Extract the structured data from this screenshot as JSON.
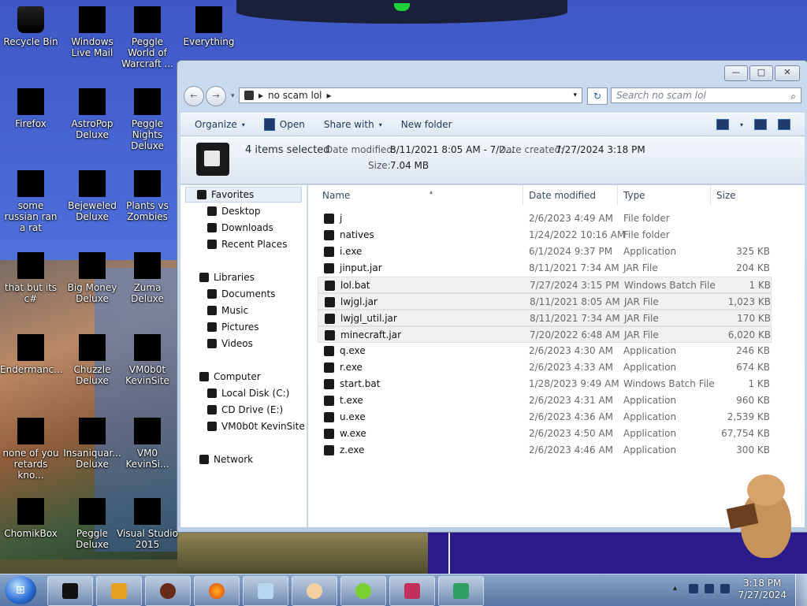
{
  "desktop": {
    "icons": [
      {
        "label": "Recycle Bin",
        "icon": "recycle-bin-icon"
      },
      {
        "label": "Windows Live Mail",
        "icon": "mail-icon"
      },
      {
        "label": "Peggle World of Warcraft ...",
        "icon": "peggle-icon"
      },
      {
        "label": "Everything",
        "icon": "everything-icon"
      },
      {
        "label": "Firefox",
        "icon": "firefox-icon"
      },
      {
        "label": "AstroPop Deluxe",
        "icon": "astropop-icon"
      },
      {
        "label": "Peggle Nights Deluxe",
        "icon": "peggle-nights-icon"
      },
      {
        "label": "some russian ran a rat",
        "icon": "app-icon"
      },
      {
        "label": "Bejeweled Deluxe",
        "icon": "bejeweled-icon"
      },
      {
        "label": "Plants vs Zombies",
        "icon": "plants-vs-zombies-icon"
      },
      {
        "label": "that but its c#",
        "icon": "app-icon"
      },
      {
        "label": "Big Money Deluxe",
        "icon": "big-money-icon"
      },
      {
        "label": "Zuma Deluxe",
        "icon": "zuma-icon"
      },
      {
        "label": "Endermanc...",
        "icon": "app-icon"
      },
      {
        "label": "Chuzzle Deluxe",
        "icon": "chuzzle-icon"
      },
      {
        "label": "VM0b0t KevinSite",
        "icon": "vm-icon"
      },
      {
        "label": "none of you retards kno...",
        "icon": "app-icon"
      },
      {
        "label": "Insaniquar... Deluxe",
        "icon": "insaniquarium-icon"
      },
      {
        "label": "VM0 KevinSi...",
        "icon": "vm-icon"
      },
      {
        "label": "ChomikBox",
        "icon": "chomikbox-icon"
      },
      {
        "label": "Peggle Deluxe",
        "icon": "peggle-icon"
      },
      {
        "label": "Visual Studio 2015",
        "icon": "visual-studio-icon"
      }
    ]
  },
  "window": {
    "caption_buttons": [
      "—",
      "□",
      "✕"
    ],
    "nav_back": "←",
    "nav_forward": "→",
    "address": {
      "sep1": "▸",
      "path": "no scam lol",
      "sep2": "▸",
      "dropdown": "▾"
    },
    "refresh_glyph": "↻",
    "search": {
      "placeholder": "Search no scam lol",
      "icon": "⌕"
    },
    "toolbar": {
      "organize": "Organize",
      "open": "Open",
      "share_with": "Share with",
      "new_folder": "New folder",
      "caret": "▾"
    },
    "details": {
      "selected": "4 items selected",
      "date_modified_label": "Date modified:",
      "date_modified_value": "8/11/2021 8:05 AM - 7/2...",
      "date_created_label": "Date created:",
      "date_created_value": "7/27/2024 3:18 PM",
      "size_label": "Size:",
      "size_value": "7.04 MB"
    },
    "nav_pane": {
      "favorites": "Favorites",
      "favorites_items": [
        "Desktop",
        "Downloads",
        "Recent Places"
      ],
      "libraries": "Libraries",
      "libraries_items": [
        "Documents",
        "Music",
        "Pictures",
        "Videos"
      ],
      "computer": "Computer",
      "computer_items": [
        "Local Disk (C:)",
        "CD Drive (E:)",
        "VM0b0t KevinSite"
      ],
      "network": "Network"
    },
    "columns": {
      "name": "Name",
      "date_modified": "Date modified",
      "type": "Type",
      "size": "Size",
      "sort_glyph": "▴"
    },
    "files": [
      {
        "name": "j",
        "date": "2/6/2023 4:49 AM",
        "type": "File folder",
        "size": ""
      },
      {
        "name": "natives",
        "date": "1/24/2022 10:16 AM",
        "type": "File folder",
        "size": ""
      },
      {
        "name": "i.exe",
        "date": "6/1/2024 9:37 PM",
        "type": "Application",
        "size": "325 KB"
      },
      {
        "name": "jinput.jar",
        "date": "8/11/2021 7:34 AM",
        "type": "JAR File",
        "size": "204 KB"
      },
      {
        "name": "lol.bat",
        "date": "7/27/2024 3:15 PM",
        "type": "Windows Batch File",
        "size": "1 KB"
      },
      {
        "name": "lwjgl.jar",
        "date": "8/11/2021 8:05 AM",
        "type": "JAR File",
        "size": "1,023 KB"
      },
      {
        "name": "lwjgl_util.jar",
        "date": "8/11/2021 7:34 AM",
        "type": "JAR File",
        "size": "170 KB"
      },
      {
        "name": "minecraft.jar",
        "date": "7/20/2022 6:48 AM",
        "type": "JAR File",
        "size": "6,020 KB"
      },
      {
        "name": "q.exe",
        "date": "2/6/2023 4:30 AM",
        "type": "Application",
        "size": "246 KB"
      },
      {
        "name": "r.exe",
        "date": "2/6/2023 4:33 AM",
        "type": "Application",
        "size": "674 KB"
      },
      {
        "name": "start.bat",
        "date": "1/28/2023 9:49 AM",
        "type": "Windows Batch File",
        "size": "1 KB"
      },
      {
        "name": "t.exe",
        "date": "2/6/2023 4:31 AM",
        "type": "Application",
        "size": "960 KB"
      },
      {
        "name": "u.exe",
        "date": "2/6/2023 4:36 AM",
        "type": "Application",
        "size": "2,539 KB"
      },
      {
        "name": "w.exe",
        "date": "2/6/2023 4:50 AM",
        "type": "Application",
        "size": "67,754 KB"
      },
      {
        "name": "z.exe",
        "date": "2/6/2023 4:46 AM",
        "type": "Application",
        "size": "300 KB"
      }
    ]
  },
  "taskbar": {
    "tray_up": "▴",
    "time": "3:18 PM",
    "date": "7/27/2024",
    "start_glyph": "⊞"
  }
}
